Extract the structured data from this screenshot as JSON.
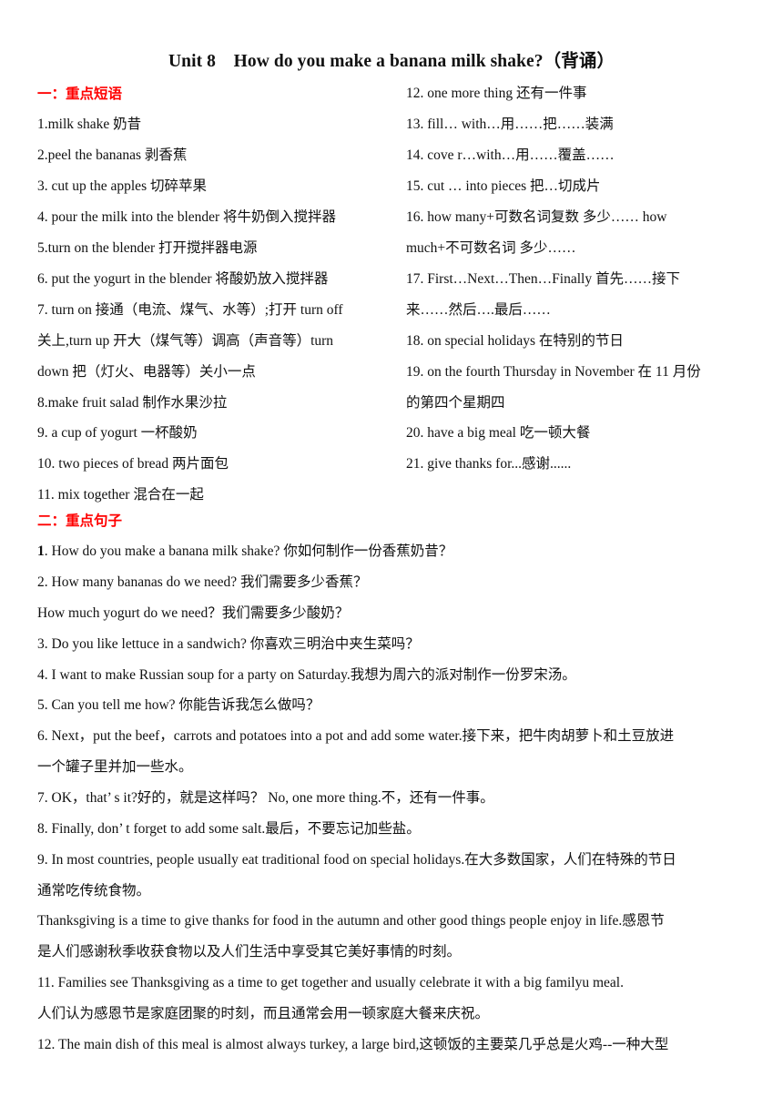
{
  "document": {
    "title": "Unit 8　How do you make a banana milk shake?（背诵）",
    "section1": {
      "heading": "一：重点短语",
      "left_lines": [
        "1.milk shake 奶昔",
        "2.peel the bananas  剥香蕉",
        "3. cut up the apples 切碎苹果",
        "4. pour the milk into the blender 将牛奶倒入搅拌器",
        "5.turn on the blender  打开搅拌器电源",
        "6. put the yogurt in the blender 将酸奶放入搅拌器",
        "7. turn on 接通（电流、煤气、水等）;打开    turn off",
        "关上,turn up  开大（煤气等）调高（声音等）turn",
        "down  把（灯火、电器等）关小一点",
        "8.make fruit salad  制作水果沙拉",
        "9. a cup of yogurt 一杯酸奶",
        "10. two pieces of bread  两片面包",
        "11. mix together    混合在一起"
      ],
      "right_lines": [
        "12. one more thing 还有一件事",
        "13. fill…  with…用……把……装满",
        "14. cove r…with…用……覆盖……",
        "15. cut  …  into pieces  把…切成片",
        "16. how many+可数名词复数  多少……    how",
        "much+不可数名词  多少……",
        "17. First…Next…Then…Finally  首先……接下",
        "来……然后….最后……",
        "18. on special holidays 在特别的节日",
        "19. on the fourth Thursday in November  在 11 月份",
        "的第四个星期四",
        "20. have a big meal 吃一顿大餐",
        "21. give thanks for...感谢......"
      ]
    },
    "section2": {
      "heading": "二：重点句子",
      "first_number": "1",
      "lines": [
        ". How do you make a banana milk shake?  你如何制作一份香蕉奶昔？",
        "2. How many bananas do we need?  我们需要多少香蕉？",
        "How much yogurt do we need？我们需要多少酸奶？",
        "3. Do you like lettuce in a sandwich?  你喜欢三明治中夹生菜吗？",
        "4. I want to make Russian soup for a party on Saturday.我想为周六的派对制作一份罗宋汤。",
        "5. Can you tell me how?  你能告诉我怎么做吗？",
        "6. Next，put the beef，carrots and potatoes into a pot and add some water.接下来，把牛肉胡萝卜和土豆放进",
        "一个罐子里并加一些水。",
        "7. OK，that’ s it?好的，就是这样吗？     No, one more thing.不，还有一件事。",
        "8. Finally, don’ t forget to add some salt.最后，不要忘记加些盐。",
        "9. In most countries, people usually eat traditional food on special holidays.在大多数国家，人们在特殊的节日",
        "通常吃传统食物。",
        "Thanksgiving is a time to give thanks for food in the autumn and other good things people enjoy in life.感恩节",
        "是人们感谢秋季收获食物以及人们生活中享受其它美好事情的时刻。",
        "11. Families see Thanksgiving as a time to get together and usually celebrate it with a big familyu meal.",
        "人们认为感恩节是家庭团聚的时刻，而且通常会用一顿家庭大餐来庆祝。",
        "12. The main dish of this meal is almost always turkey, a large bird,这顿饭的主要菜几乎总是火鸡--一种大型"
      ]
    }
  }
}
